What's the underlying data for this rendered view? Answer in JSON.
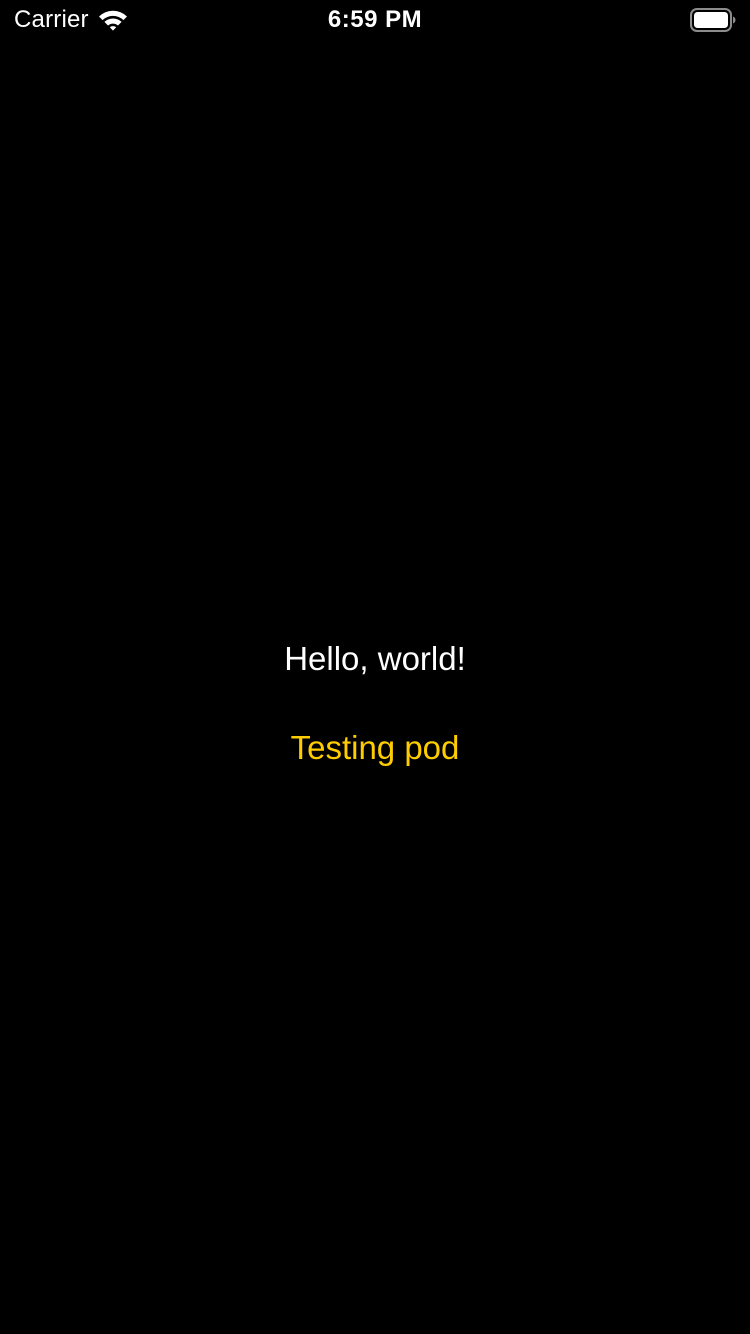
{
  "status_bar": {
    "carrier": "Carrier",
    "time": "6:59 PM",
    "wifi_icon": "wifi-icon",
    "battery_icon": "battery-icon"
  },
  "main": {
    "greeting": "Hello, world!",
    "pod_label": "Testing pod"
  },
  "colors": {
    "background": "#000000",
    "text_primary": "#ffffff",
    "accent": "#ffcc00"
  }
}
